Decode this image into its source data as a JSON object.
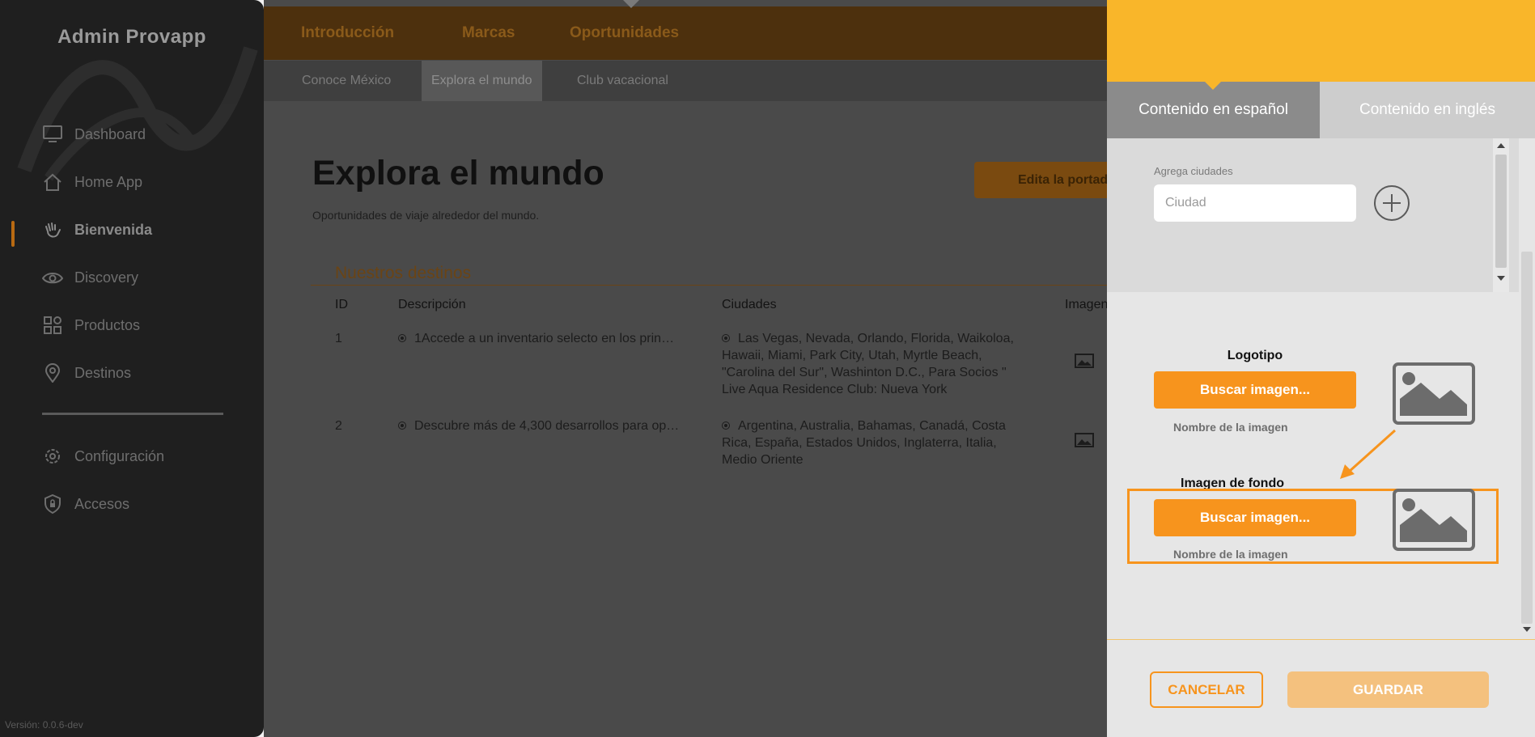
{
  "app": {
    "title": "Admin Provapp",
    "version": "Versión: 0.0.6-dev"
  },
  "sidebar": {
    "items": [
      {
        "label": "Dashboard",
        "icon": "monitor-icon"
      },
      {
        "label": "Home App",
        "icon": "home-icon"
      },
      {
        "label": "Bienvenida",
        "icon": "wave-hand-icon",
        "active": true
      },
      {
        "label": "Discovery",
        "icon": "eye-icon"
      },
      {
        "label": "Productos",
        "icon": "grid-icon"
      },
      {
        "label": "Destinos",
        "icon": "map-pin-icon"
      }
    ],
    "bottom_items": [
      {
        "label": "Configuración",
        "icon": "gear-icon"
      },
      {
        "label": "Accesos",
        "icon": "shield-lock-icon"
      }
    ]
  },
  "topnav": {
    "tabs": [
      "Introducción",
      "Marcas",
      "Oportunidades"
    ],
    "active": "Oportunidades"
  },
  "subnav": {
    "tabs": [
      "Conoce México",
      "Explora el mundo",
      "Club vacacional"
    ],
    "active": "Explora el mundo"
  },
  "page": {
    "title": "Explora el mundo",
    "subtitle": "Oportunidades de viaje alrededor del mundo.",
    "edit_button": "Edita la portada"
  },
  "section": {
    "title": "Nuestros destinos",
    "columns": [
      "ID",
      "Descripción",
      "Ciudades",
      "Imagen"
    ],
    "rows": [
      {
        "id": "1",
        "descripcion": "1Accede a un inventario selecto en los prin…",
        "ciudades": [
          "Las Vegas, Nevada, Orlando, Florida, Waikoloa,",
          "Hawaii, Miami, Park City, Utah, Myrtle Beach,",
          "\"Carolina del Sur\", Washinton D.C., Para Socios \"",
          "Live Aqua Residence Club: Nueva York"
        ]
      },
      {
        "id": "2",
        "descripcion": "Descubre más de 4,300 desarrollos para op…",
        "ciudades": [
          "Argentina, Australia, Bahamas, Canadá, Costa",
          "Rica, España, Estados Unidos, Inglaterra, Italia,",
          "Medio Oriente"
        ]
      }
    ]
  },
  "panel": {
    "tabs": {
      "es": "Contenido en español",
      "en": "Contenido en inglés"
    },
    "cities_label": "Agrega ciudades",
    "city_placeholder": "Ciudad",
    "logo": {
      "title": "Logotipo",
      "button": "Buscar imagen...",
      "file_name": "Nombre de la imagen"
    },
    "background": {
      "title": "Imagen de fondo",
      "button": "Buscar imagen...",
      "file_name": "Nombre de la imagen"
    },
    "cancel": "CANCELAR",
    "save": "GUARDAR"
  },
  "colors": {
    "accent": "#f7941d",
    "panel_header": "#f9b62a",
    "sidebar": "#1f1f1f"
  }
}
